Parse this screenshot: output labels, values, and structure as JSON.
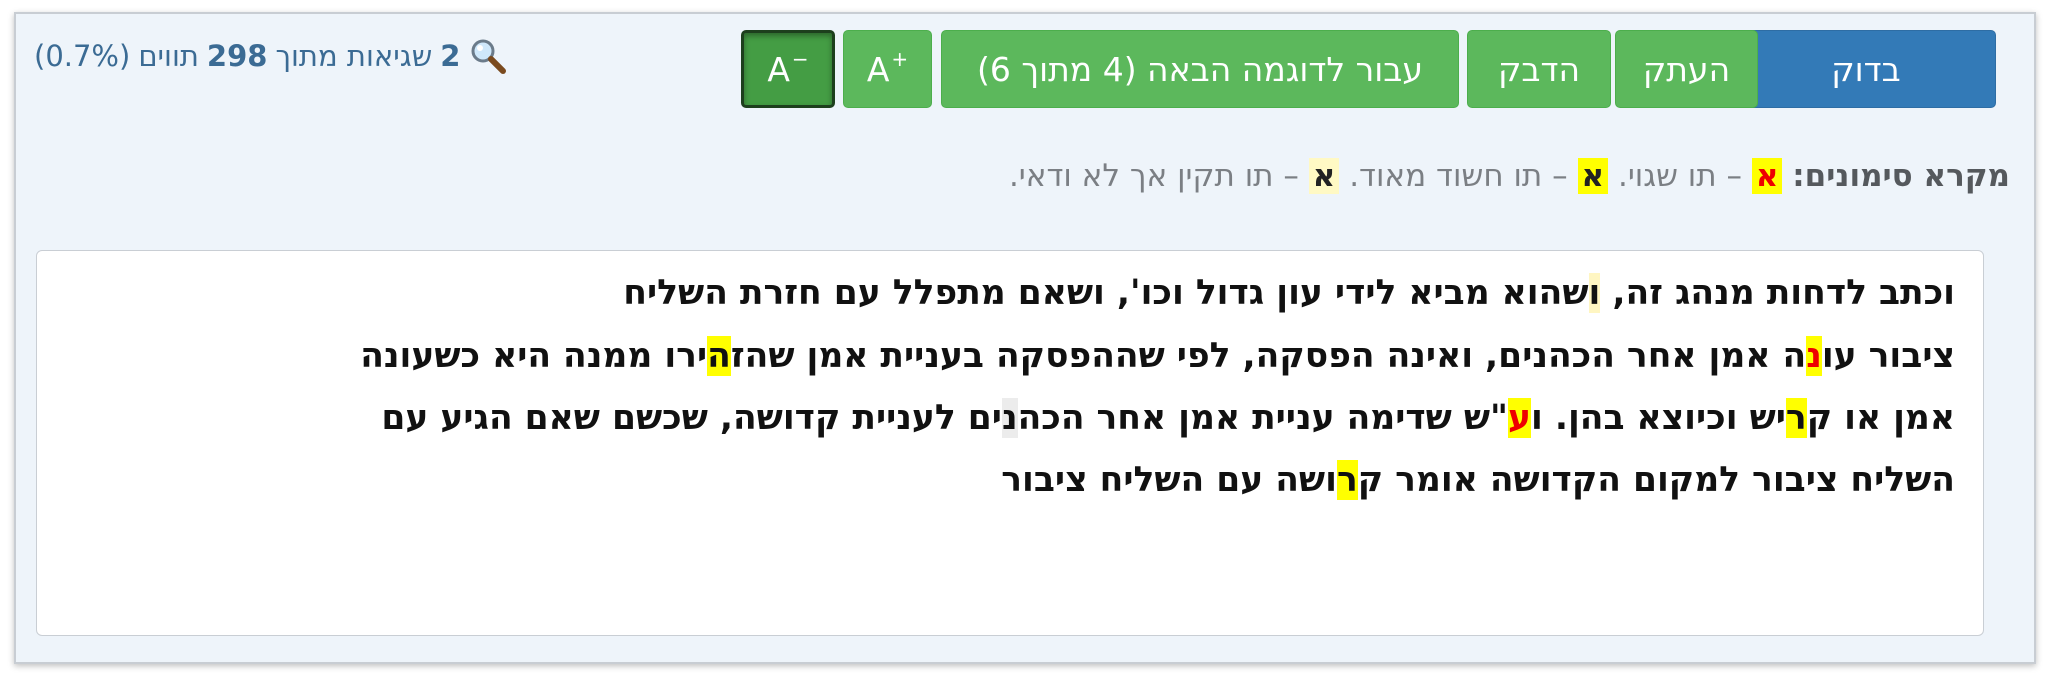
{
  "stats": {
    "errors": "2",
    "errors_label": "שגיאות מתוך",
    "total": "298",
    "chars_label": "תווים",
    "percent": "(0.7%)"
  },
  "toolbar": {
    "check": "בדוק",
    "copy": "העתק",
    "paste": "הדבק",
    "next_example": "עבור לדוגמה הבאה (4 מתוך 6)",
    "font_up": "A",
    "font_up_sup": "+",
    "font_down": "A",
    "font_down_sup": "−"
  },
  "legend": {
    "title": "מקרא סימונים:",
    "sample": "א",
    "dash": "–",
    "error_desc": "תו שגוי.",
    "suspect_desc": "תו חשוד מאוד.",
    "uncertain_desc": "תו תקין אך לא ודאי."
  },
  "text": {
    "line1": [
      {
        "t": "וכתב לדחות מנהג זה, ",
        "h": ""
      },
      {
        "t": "ו",
        "h": "unc"
      },
      {
        "t": "שהוא מביא לידי עון גדול וכו', ושאם מתפלל עם חזרת השליח",
        "h": ""
      }
    ],
    "line2": [
      {
        "t": "ציבור עו",
        "h": ""
      },
      {
        "t": "נ",
        "h": "err"
      },
      {
        "t": "ה אמן אחר הכהנים, ואינה הפסקה, לפי שההפסקה בעניית אמן שהז",
        "h": ""
      },
      {
        "t": "ה",
        "h": "sus"
      },
      {
        "t": "ירו ממנה היא כשעונה",
        "h": ""
      }
    ],
    "line3": [
      {
        "t": "אמן או ק",
        "h": ""
      },
      {
        "t": "ר",
        "h": "sus"
      },
      {
        "t": "יש וכיוצא בהן. ו",
        "h": ""
      },
      {
        "t": "ע",
        "h": "err"
      },
      {
        "t": "\"ש שדימה עניית אמן אחר הכה",
        "h": ""
      },
      {
        "t": "נ",
        "h": "gray"
      },
      {
        "t": "ים לעניית קדושה, שכשם שאם הגיע עם",
        "h": ""
      }
    ],
    "line4": [
      {
        "t": "השליח ציבור למקום הקדושה אומר ק",
        "h": ""
      },
      {
        "t": "ר",
        "h": "sus"
      },
      {
        "t": "ושה עם השליח ציבור",
        "h": ""
      }
    ]
  }
}
